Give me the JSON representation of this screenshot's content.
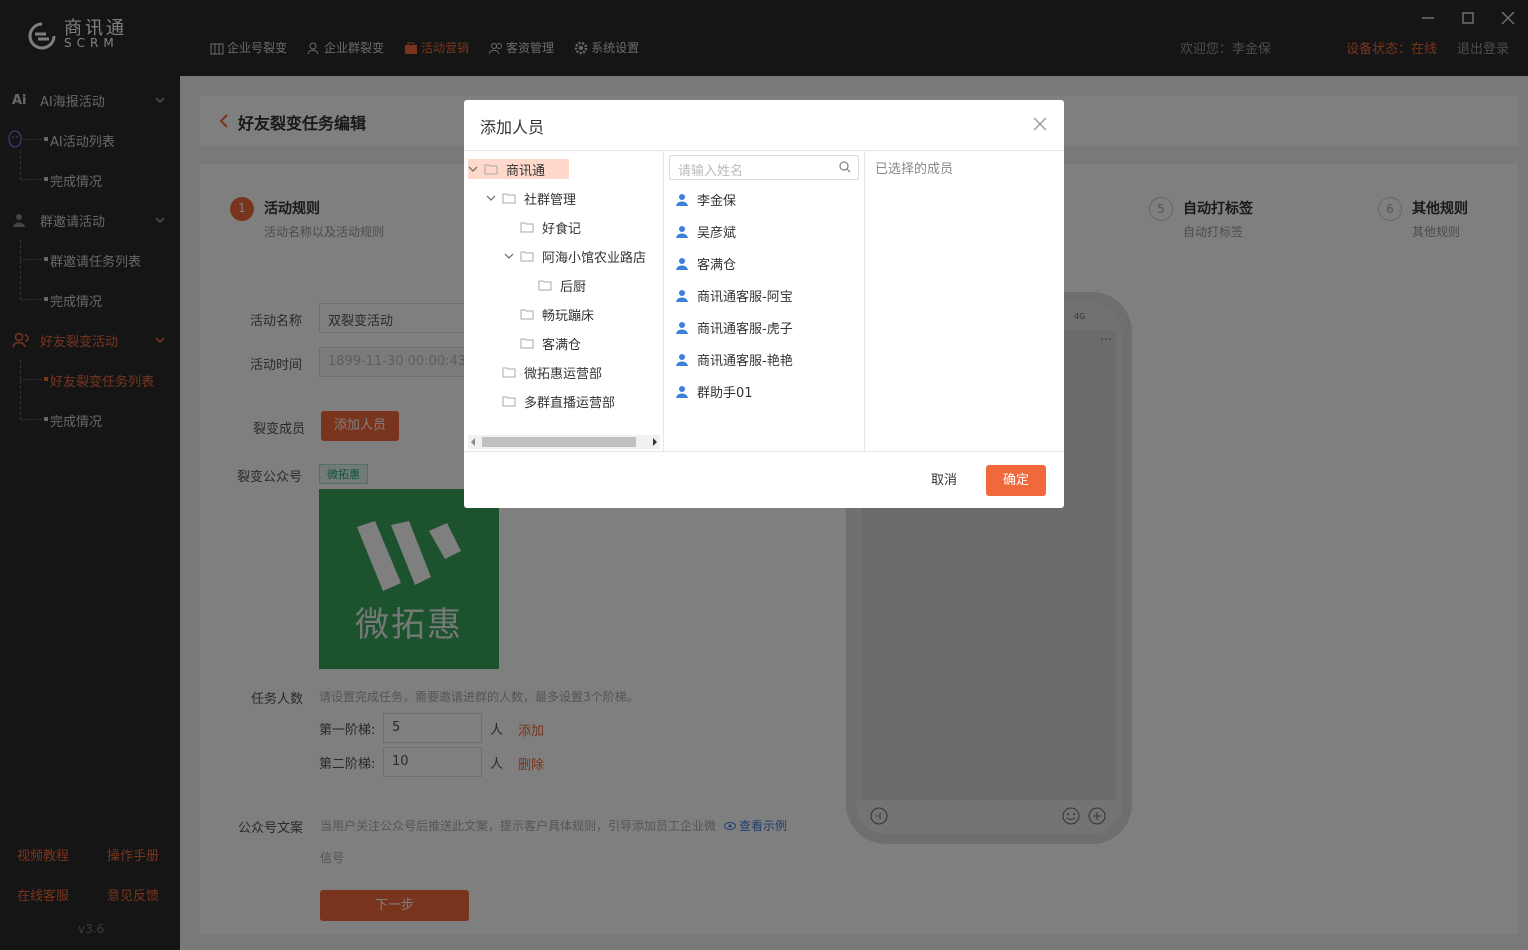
{
  "app": {
    "logo_cn": "商讯通",
    "logo_en": "SCRM"
  },
  "nav": [
    {
      "label": "企业号裂变",
      "icon": "building-icon"
    },
    {
      "label": "企业群裂变",
      "icon": "users-icon"
    },
    {
      "label": "活动营销",
      "icon": "bag-icon",
      "active": true
    },
    {
      "label": "客资管理",
      "icon": "people-icon"
    },
    {
      "label": "系统设置",
      "icon": "gear-icon"
    }
  ],
  "header": {
    "welcome": "欢迎您：李金保",
    "device_status": "设备状态：在线",
    "logout": "退出登录"
  },
  "sidebar": {
    "groups": [
      {
        "label": "AI海报活动",
        "icon_text": "Ai"
      },
      {
        "label": "群邀请活动"
      },
      {
        "label": "好友裂变活动",
        "active": true
      }
    ],
    "subs": [
      "AI活动列表",
      "完成情况",
      "群邀请任务列表",
      "完成情况",
      "好友裂变任务列表",
      "完成情况"
    ],
    "footer": [
      "视频教程",
      "操作手册",
      "在线客服",
      "意见反馈"
    ],
    "version": "v3.6"
  },
  "page": {
    "title": "好友裂变任务编辑"
  },
  "steps": [
    {
      "num": "1",
      "title": "活动规则",
      "desc": "活动名称以及活动规则"
    },
    {
      "num": "5",
      "title": "自动打标签",
      "desc": "自动打标签"
    },
    {
      "num": "6",
      "title": "其他规则",
      "desc": "其他规则"
    }
  ],
  "form": {
    "name_label": "活动名称",
    "name_value": "双裂变活动",
    "time_label": "活动时间",
    "time_value": "1899-11-30 00:00:43",
    "members_label": "裂变成员",
    "add_member_btn": "添加人员",
    "account_label": "裂变公众号",
    "account_tag": "微拓惠",
    "qr_text": "微拓惠",
    "task_label": "任务人数",
    "task_hint": "请设置完成任务，需要邀请进群的人数，最多设置3个阶梯。",
    "tier1_label": "第一阶梯:",
    "tier1_value": "5",
    "tier2_label": "第二阶梯:",
    "tier2_value": "10",
    "unit": "人",
    "add_link": "添加",
    "delete_link": "删除",
    "copy_label": "公众号文案",
    "copy_hint": "当用户关注公众号后推送此文案，提示客户具体规则，引导添加员工企业微",
    "copy_hint2": "信号",
    "example_link": "查看示例",
    "next_btn": "下一步"
  },
  "phone": {
    "status": "4G"
  },
  "modal": {
    "title": "添加人员",
    "search_placeholder": "请输入姓名",
    "selected_title": "已选择的成员",
    "cancel": "取消",
    "ok": "确定",
    "tree": [
      {
        "label": "商讯通",
        "level": 0,
        "caret": "down",
        "selected": true
      },
      {
        "label": "社群管理",
        "level": 1,
        "caret": "down"
      },
      {
        "label": "好食记",
        "level": 2
      },
      {
        "label": "阿海小馆农业路店",
        "level": 2,
        "caret": "down"
      },
      {
        "label": "后厨",
        "level": 3
      },
      {
        "label": "畅玩蹦床",
        "level": 2
      },
      {
        "label": "客满仓",
        "level": 2
      },
      {
        "label": "微拓惠运营部",
        "level": 1
      },
      {
        "label": "多群直播运营部",
        "level": 1
      }
    ],
    "people": [
      "李金保",
      "吴彦斌",
      "客满仓",
      "商讯通客服-阿宝",
      "商讯通客服-虎子",
      "商讯通客服-艳艳",
      "群助手01"
    ]
  },
  "colors": {
    "accent": "#f0683b",
    "sidebar_bg": "#2b2b2b",
    "qr_green": "#38a55a",
    "link_blue": "#3e7fe0"
  }
}
